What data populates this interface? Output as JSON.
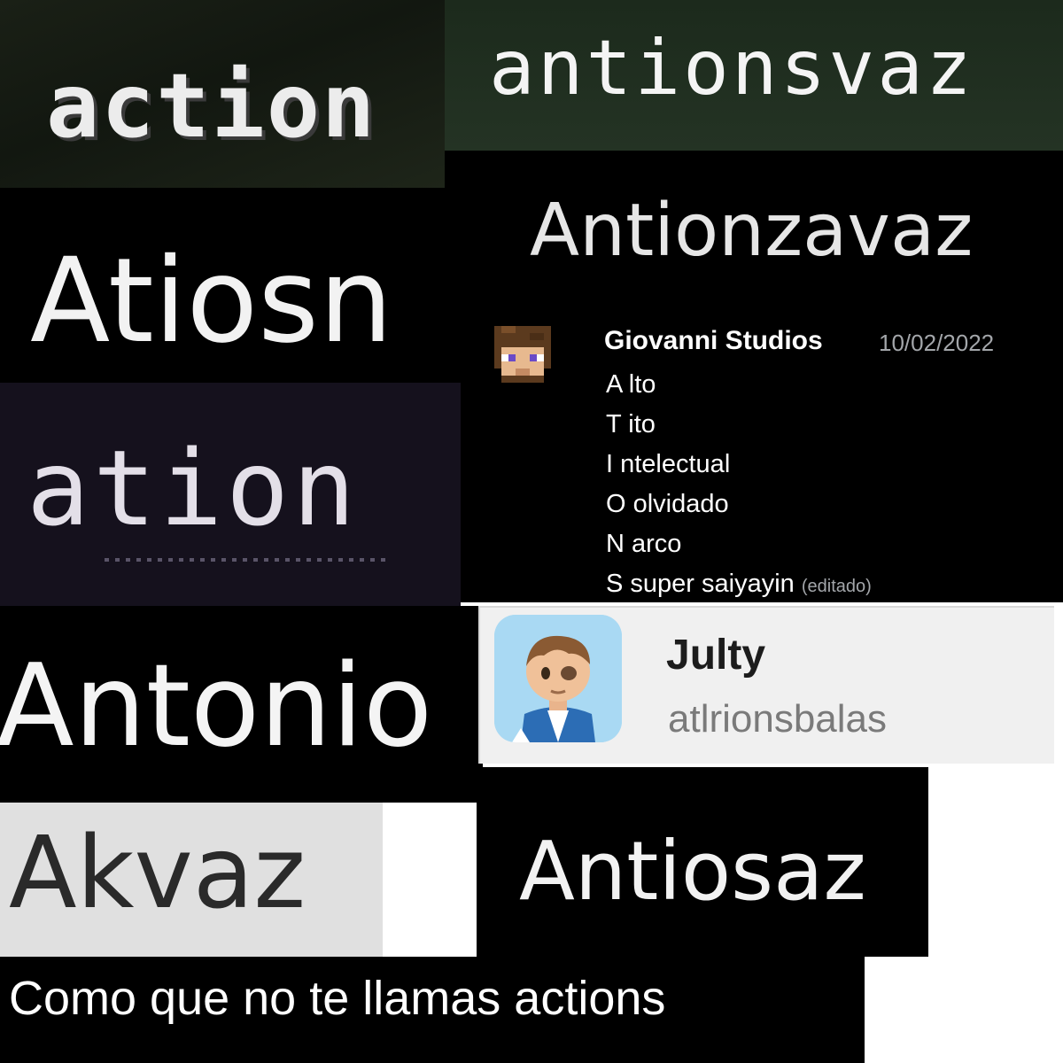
{
  "tiles": {
    "action": "action",
    "antionsvaz": "antionsvaz",
    "antionzavaz": "Antionzavaz",
    "atiosn": "Atiosn",
    "ation": "ation",
    "antonio": "Antonio",
    "akvaz": "Akvaz",
    "antiosaz": "Antiosaz"
  },
  "discord_message": {
    "author": "Giovanni Studios",
    "date": "10/02/2022",
    "lines": [
      "A lto",
      "T ito",
      "I ntelectual",
      "O olvidado",
      "N arco",
      "S super saiyayin"
    ],
    "edited_tag": "(editado)",
    "avatar_icon": "pixel-skin-avatar-icon"
  },
  "profile": {
    "name": "Julty",
    "handle": "atlrionsbalas",
    "avatar_icon": "cartoon-avatar-icon"
  },
  "caption": "Como que no te llamas actions"
}
